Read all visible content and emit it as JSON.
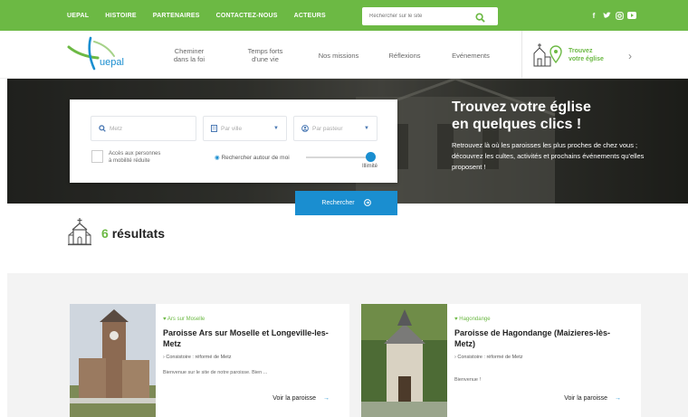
{
  "topbar": {
    "nav": [
      "UEPAL",
      "HISTOIRE",
      "PARTENAIRES",
      "CONTACTEZ-NOUS",
      "ACTEURS"
    ],
    "search_placeholder": "Rechercher sur le site"
  },
  "header": {
    "logo_text": "uepal",
    "nav": [
      {
        "line1": "Cheminer",
        "line2": "dans la foi"
      },
      {
        "line1": "Temps forts",
        "line2": "d'une vie"
      },
      {
        "line1": "Nos missions",
        "line2": ""
      },
      {
        "line1": "Réflexions",
        "line2": ""
      },
      {
        "line1": "Evénements",
        "line2": ""
      }
    ],
    "find_line1": "Trouvez",
    "find_line2": "votre église"
  },
  "hero": {
    "title_line1": "Trouvez votre église",
    "title_line2": "en quelques clics !",
    "subtitle": "Retrouvez là où les paroisses les plus proches de chez vous ; découvrez les cultes, activités et prochains événements qu'elles proposent !",
    "search": {
      "location_value": "Metz",
      "city_placeholder": "Par ville",
      "pastor_placeholder": "Par pasteur",
      "accessibility_label_line1": "Accès aux personnes",
      "accessibility_label_line2": "à mobilité réduite",
      "geo_label": "Rechercher autour de moi",
      "limit_label": "Illimité",
      "button_label": "Rechercher"
    }
  },
  "results": {
    "count": "6",
    "label": "résultats"
  },
  "cards": [
    {
      "location": "Ars sur Moselle",
      "title": "Paroisse Ars sur Moselle et Longeville-les-Metz",
      "consistoire": "Consistoire : réformé de Metz",
      "excerpt": "Bienvenue sur le site de notre paroisse. Bien ...",
      "more": "Voir la paroisse"
    },
    {
      "location": "Hagondange",
      "title": "Paroisse de Hagondange (Maizieres-lès-Metz)",
      "consistoire": "Consistoire : réformé de Metz",
      "excerpt": "Bienvenue !",
      "more": "Voir la paroisse"
    }
  ],
  "colors": {
    "brand_green": "#6cb944",
    "accent_blue": "#1a8ed0"
  },
  "icons": [
    "search-icon",
    "facebook-icon",
    "twitter-icon",
    "instagram-icon",
    "youtube-icon",
    "church-icon",
    "map-pin-icon",
    "chevron-right-icon",
    "building-icon",
    "user-icon",
    "target-icon",
    "arrow-right-icon"
  ]
}
